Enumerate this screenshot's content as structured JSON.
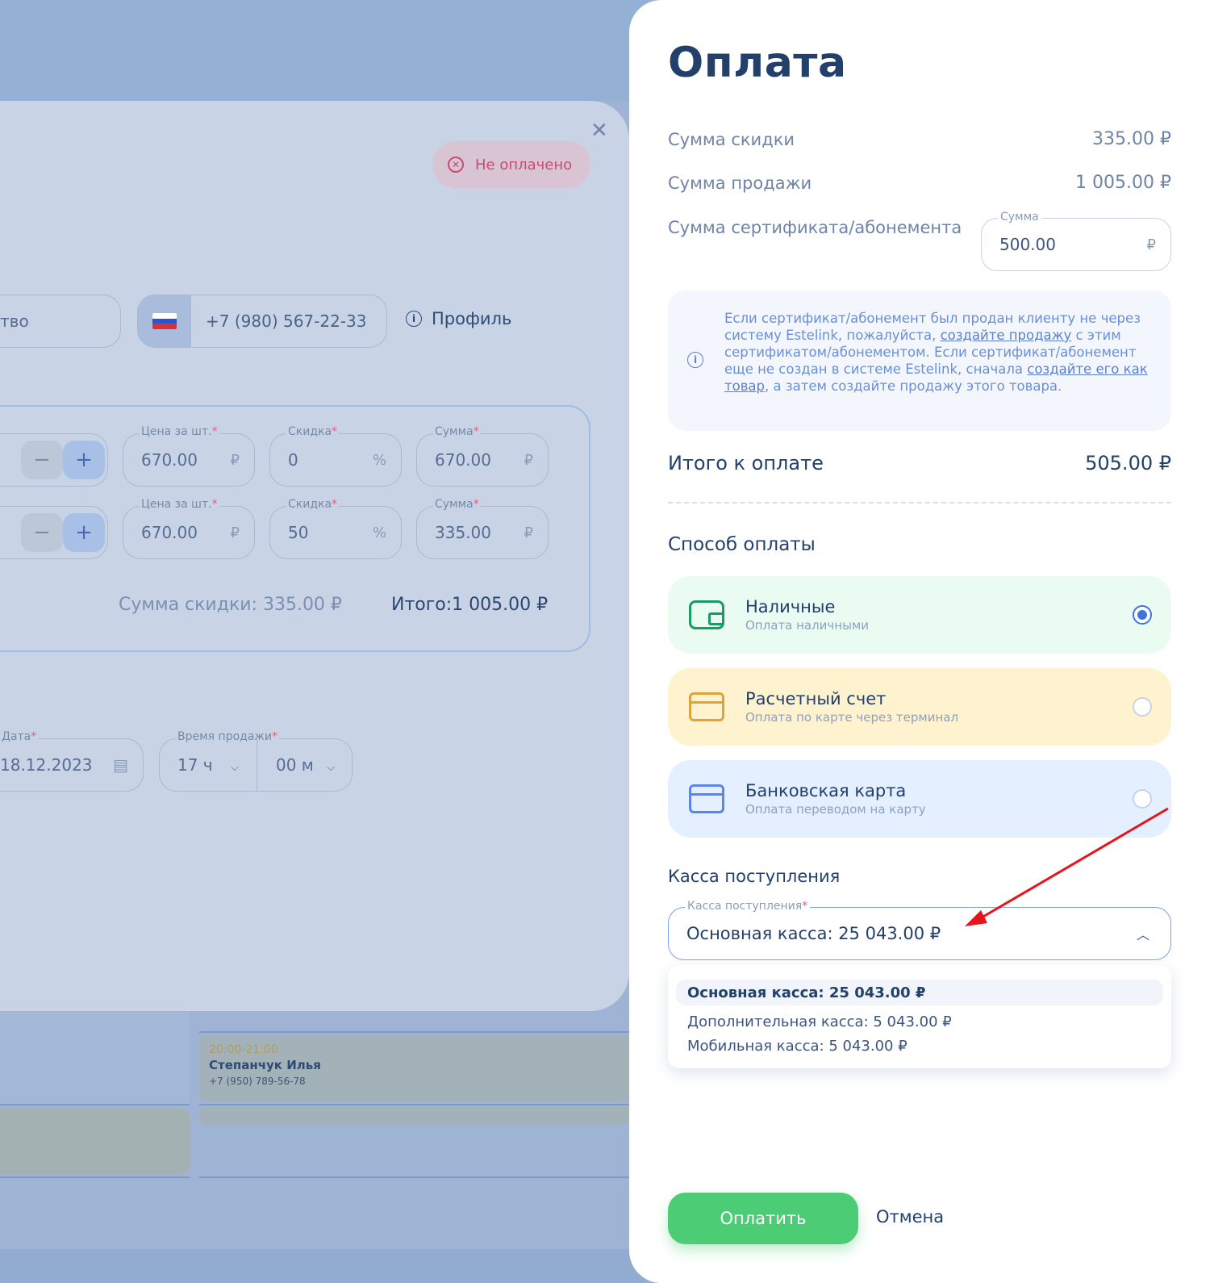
{
  "background": {
    "event": {
      "time": "20:00-21:00",
      "name": "Степанчук Илья",
      "phone": "+7 (950) 789-56-78"
    }
  },
  "sale_modal": {
    "status": "Не оплачено",
    "partial_field_text": "тво",
    "phone": "+7 (980) 567-22-33",
    "profile_link": "Профиль",
    "rows": [
      {
        "price_label": "Цена за шт.",
        "price": "670.00",
        "discount_label": "Скидка",
        "discount": "0",
        "sum_label": "Сумма",
        "sum": "670.00"
      },
      {
        "price_label": "Цена за шт.",
        "price": "670.00",
        "discount_label": "Скидка",
        "discount": "50",
        "sum_label": "Сумма",
        "sum": "335.00"
      }
    ],
    "currency": "₽",
    "percent": "%",
    "discount_total_label": "Сумма скидки:",
    "discount_total": "335.00 ₽",
    "grand_total_label": "Итого:",
    "grand_total": "1 005.00 ₽",
    "date_label": "Дата",
    "date": "18.12.2023",
    "time_label": "Время продажи",
    "hours": "17 ч",
    "minutes": "00 м",
    "minus": "−",
    "plus": "+"
  },
  "payment": {
    "title": "Оплата",
    "discount_label": "Сумма скидки",
    "discount_value": "335.00 ₽",
    "sale_label": "Сумма продажи",
    "sale_value": "1 005.00 ₽",
    "cert_label": "Сумма сертификата/абонемента",
    "cert_field_label": "Сумма",
    "cert_field_value": "500.00",
    "cert_field_unit": "₽",
    "info": {
      "part1": "Если сертификат/абонемент был продан клиенту не через систему Estelink, пожалуйста, ",
      "link1": "создайте продажу",
      "part2": " с этим сертификатом/абонементом. Если сертификат/абонемент еще не создан в системе Estelink, сначала ",
      "link2": "создайте его как товар",
      "part3": ", а затем создайте продажу этого товара."
    },
    "total_label": "Итого к оплате",
    "total_value": "505.00 ₽",
    "method_title": "Способ оплаты",
    "methods": [
      {
        "title": "Наличные",
        "subtitle": "Оплата наличными",
        "selected": true,
        "bg": "#eafcf2"
      },
      {
        "title": "Расчетный счет",
        "subtitle": "Оплата по карте через терминал",
        "selected": false,
        "bg": "#fff3cf"
      },
      {
        "title": "Банковская карта",
        "subtitle": "Оплата переводом на карту",
        "selected": false,
        "bg": "#e4efff"
      }
    ],
    "cashbox_title": "Касса поступления",
    "cashbox_field_label": "Касса поступления",
    "cashbox_value": "Основная касса: 25 043.00 ₽",
    "cashbox_options": [
      "Основная касса: 25 043.00 ₽",
      "Дополнительная касса: 5 043.00 ₽",
      "Мобильная касса: 5 043.00 ₽"
    ],
    "pay_button": "Оплатить",
    "cancel_button": "Отмена"
  },
  "colors": {
    "accent": "#4ccc74",
    "primary_text": "#23406b",
    "link": "#5c80cf",
    "arrow": "#e8141c"
  }
}
